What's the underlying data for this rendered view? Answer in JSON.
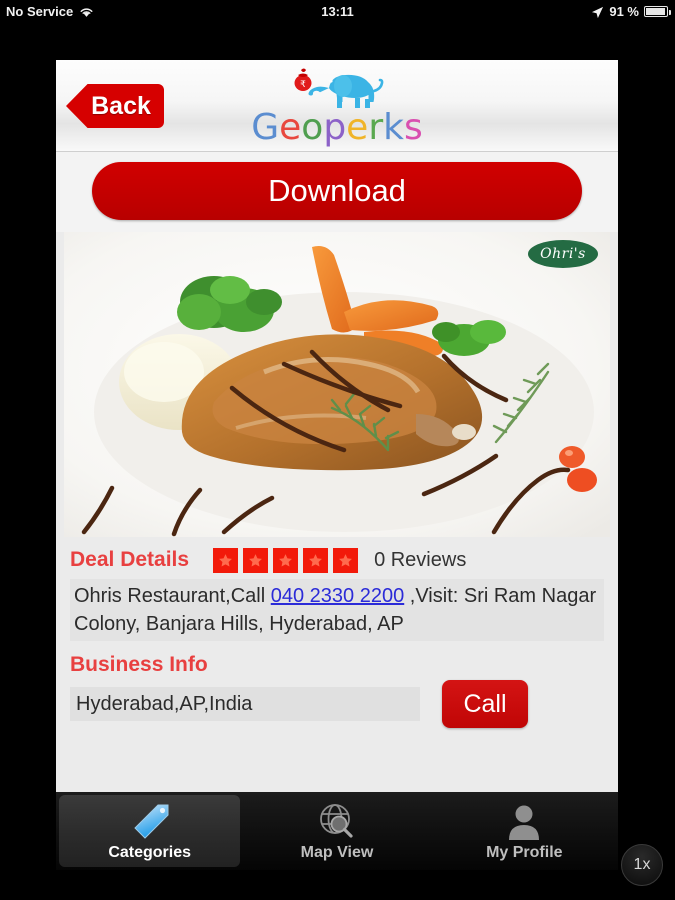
{
  "statusbar": {
    "carrier": "No Service",
    "wifi_icon": "wifi-icon",
    "time": "13:11",
    "location_icon": "location-arrow-icon",
    "battery_percent": "91 %",
    "battery_icon": "battery-icon"
  },
  "navbar": {
    "back_label": "Back",
    "logo_icon": "elephant-logo-icon",
    "wordmark": [
      {
        "ch": "G",
        "color": "#5b8dd0"
      },
      {
        "ch": "e",
        "color": "#e8483f"
      },
      {
        "ch": "o",
        "color": "#4f9e4f"
      },
      {
        "ch": "p",
        "color": "#8c62c8"
      },
      {
        "ch": "e",
        "color": "#f0b429"
      },
      {
        "ch": "r",
        "color": "#5aa84f"
      },
      {
        "ch": "k",
        "color": "#5b8dd0"
      },
      {
        "ch": "s",
        "color": "#d94fb0"
      }
    ]
  },
  "download": {
    "label": "Download"
  },
  "photo": {
    "alt": "Plated chicken with gravy, mashed potatoes, broccoli, carrots and rosemary",
    "brand_badge": "Ohri's"
  },
  "deal": {
    "section_title": "Deal Details",
    "rating_stars": 5,
    "reviews_label": "0 Reviews",
    "text_before": "Ohris Restaurant,Call ",
    "phone": "040 2330 2200",
    "text_after": " ,Visit: Sri Ram Nagar Colony, Banjara Hills, Hyderabad, AP"
  },
  "business": {
    "section_title": "Business Info",
    "location": "Hyderabad,AP,India",
    "call_label": "Call"
  },
  "tabbar": {
    "items": [
      {
        "label": "Categories",
        "icon": "tag-icon",
        "active": true
      },
      {
        "label": "Map View",
        "icon": "globe-search-icon",
        "active": false
      },
      {
        "label": "My Profile",
        "icon": "person-icon",
        "active": false
      }
    ]
  },
  "zoom_badge": {
    "label": "1x"
  },
  "colors": {
    "brand_red": "#c40000",
    "accent_red": "#e84040",
    "link_blue": "#2b2bd8",
    "panel_bg": "#ebebeb",
    "field_bg": "#e3e3e3"
  }
}
